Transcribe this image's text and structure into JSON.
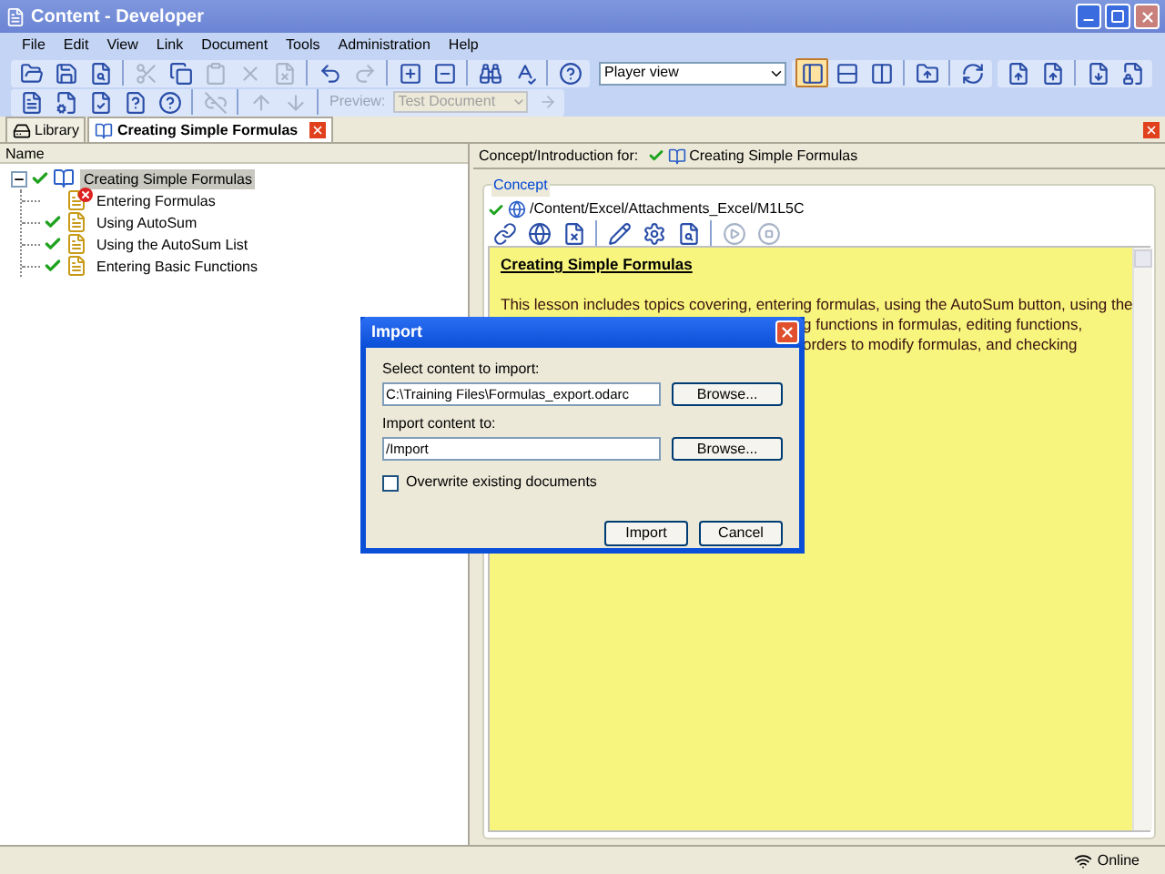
{
  "window": {
    "title": "Content - Developer"
  },
  "menu": [
    "File",
    "Edit",
    "View",
    "Link",
    "Document",
    "Tools",
    "Administration",
    "Help"
  ],
  "toolbar_1": {
    "buttons_left": [
      {
        "kind": "button",
        "disabled": false
      },
      {
        "kind": "button",
        "disabled": false
      },
      {
        "kind": "button",
        "disabled": false
      },
      {
        "kind": "separator"
      },
      {
        "kind": "button",
        "disabled": true
      },
      {
        "kind": "button",
        "disabled": false
      },
      {
        "kind": "button",
        "disabled": true
      },
      {
        "kind": "button",
        "disabled": true
      },
      {
        "kind": "button",
        "disabled": true
      },
      {
        "kind": "separator"
      },
      {
        "kind": "button",
        "disabled": false
      },
      {
        "kind": "button",
        "disabled": true
      },
      {
        "kind": "separator"
      },
      {
        "kind": "button",
        "disabled": false
      },
      {
        "kind": "button",
        "disabled": false
      },
      {
        "kind": "separator"
      },
      {
        "kind": "button",
        "disabled": false
      },
      {
        "kind": "button",
        "disabled": false
      },
      {
        "kind": "separator"
      },
      {
        "kind": "button",
        "disabled": false
      }
    ],
    "view_select": {
      "value": "Player view"
    },
    "buttons_right": [
      {
        "kind": "button",
        "selected": true
      },
      {
        "kind": "button",
        "selected": false
      },
      {
        "kind": "button",
        "selected": false
      },
      {
        "kind": "separator"
      },
      {
        "kind": "button",
        "selected": false
      },
      {
        "kind": "separator"
      },
      {
        "kind": "button",
        "selected": false
      }
    ],
    "buttons_extra": [
      {
        "kind": "button"
      },
      {
        "kind": "button"
      },
      {
        "kind": "separator"
      },
      {
        "kind": "button"
      },
      {
        "kind": "button"
      }
    ]
  },
  "toolbar_2": {
    "buttons": [
      {
        "kind": "button",
        "disabled": false
      },
      {
        "kind": "button",
        "disabled": false
      },
      {
        "kind": "button",
        "disabled": false
      },
      {
        "kind": "button",
        "disabled": false
      },
      {
        "kind": "button",
        "disabled": false
      },
      {
        "kind": "separator"
      },
      {
        "kind": "button",
        "disabled": true
      },
      {
        "kind": "separator"
      },
      {
        "kind": "button",
        "disabled": true
      },
      {
        "kind": "button",
        "disabled": true
      },
      {
        "kind": "separator"
      }
    ],
    "preview_label": "Preview:",
    "preview_select": {
      "value": "Test Document",
      "disabled": true
    },
    "go_disabled": true
  },
  "tabs": [
    {
      "label": "Library",
      "selected": false
    },
    {
      "label": "Creating Simple Formulas",
      "selected": true
    }
  ],
  "tree": {
    "column": "Name",
    "items": [
      {
        "label": "Creating Simple Formulas",
        "checked": true,
        "error": false,
        "selected": true,
        "expanded": true,
        "children": [
          {
            "label": "Entering Formulas",
            "checked": false,
            "error": true,
            "selected": false
          },
          {
            "label": "Using AutoSum",
            "checked": true,
            "error": false,
            "selected": false
          },
          {
            "label": "Using the AutoSum List",
            "checked": true,
            "error": false,
            "selected": false
          },
          {
            "label": "Entering Basic Functions",
            "checked": true,
            "error": false,
            "selected": false
          }
        ]
      }
    ]
  },
  "detail": {
    "header_label": "Concept/Introduction for:",
    "header_title": "Creating Simple Formulas",
    "group": "Concept",
    "path": "/Content/Excel/Attachments_Excel/M1L5C",
    "tools": [
      {
        "kind": "button",
        "disabled": false
      },
      {
        "kind": "button",
        "disabled": false
      },
      {
        "kind": "button",
        "disabled": false
      },
      {
        "kind": "separator"
      },
      {
        "kind": "button",
        "disabled": false
      },
      {
        "kind": "button",
        "disabled": false
      },
      {
        "kind": "button",
        "disabled": false
      },
      {
        "kind": "separator"
      },
      {
        "kind": "button",
        "disabled": true
      },
      {
        "kind": "button",
        "disabled": true
      }
    ],
    "content_title": "Creating Simple Formulas",
    "lines": [
      {
        "text": "This lesson includes topics covering, entering formulas, using the AutoSum button, using the",
        "clipped": false
      },
      {
        "text": "g functions in formulas, editing functions,",
        "clipped": true
      },
      {
        "text": "orders to modify formulas, and checking",
        "clipped": true
      }
    ]
  },
  "dialog": {
    "title": "Import",
    "fields": [
      {
        "label": "Select content to import:",
        "value": "C:\\Training Files\\Formulas_export.odarc",
        "button": "Browse..."
      },
      {
        "label": "Import content to:",
        "value": "/Import",
        "button": "Browse..."
      }
    ],
    "checkbox": {
      "label": "Overwrite existing documents",
      "checked": false
    },
    "buttons": [
      "Import",
      "Cancel"
    ]
  },
  "status_bar": {
    "status": "Online"
  }
}
